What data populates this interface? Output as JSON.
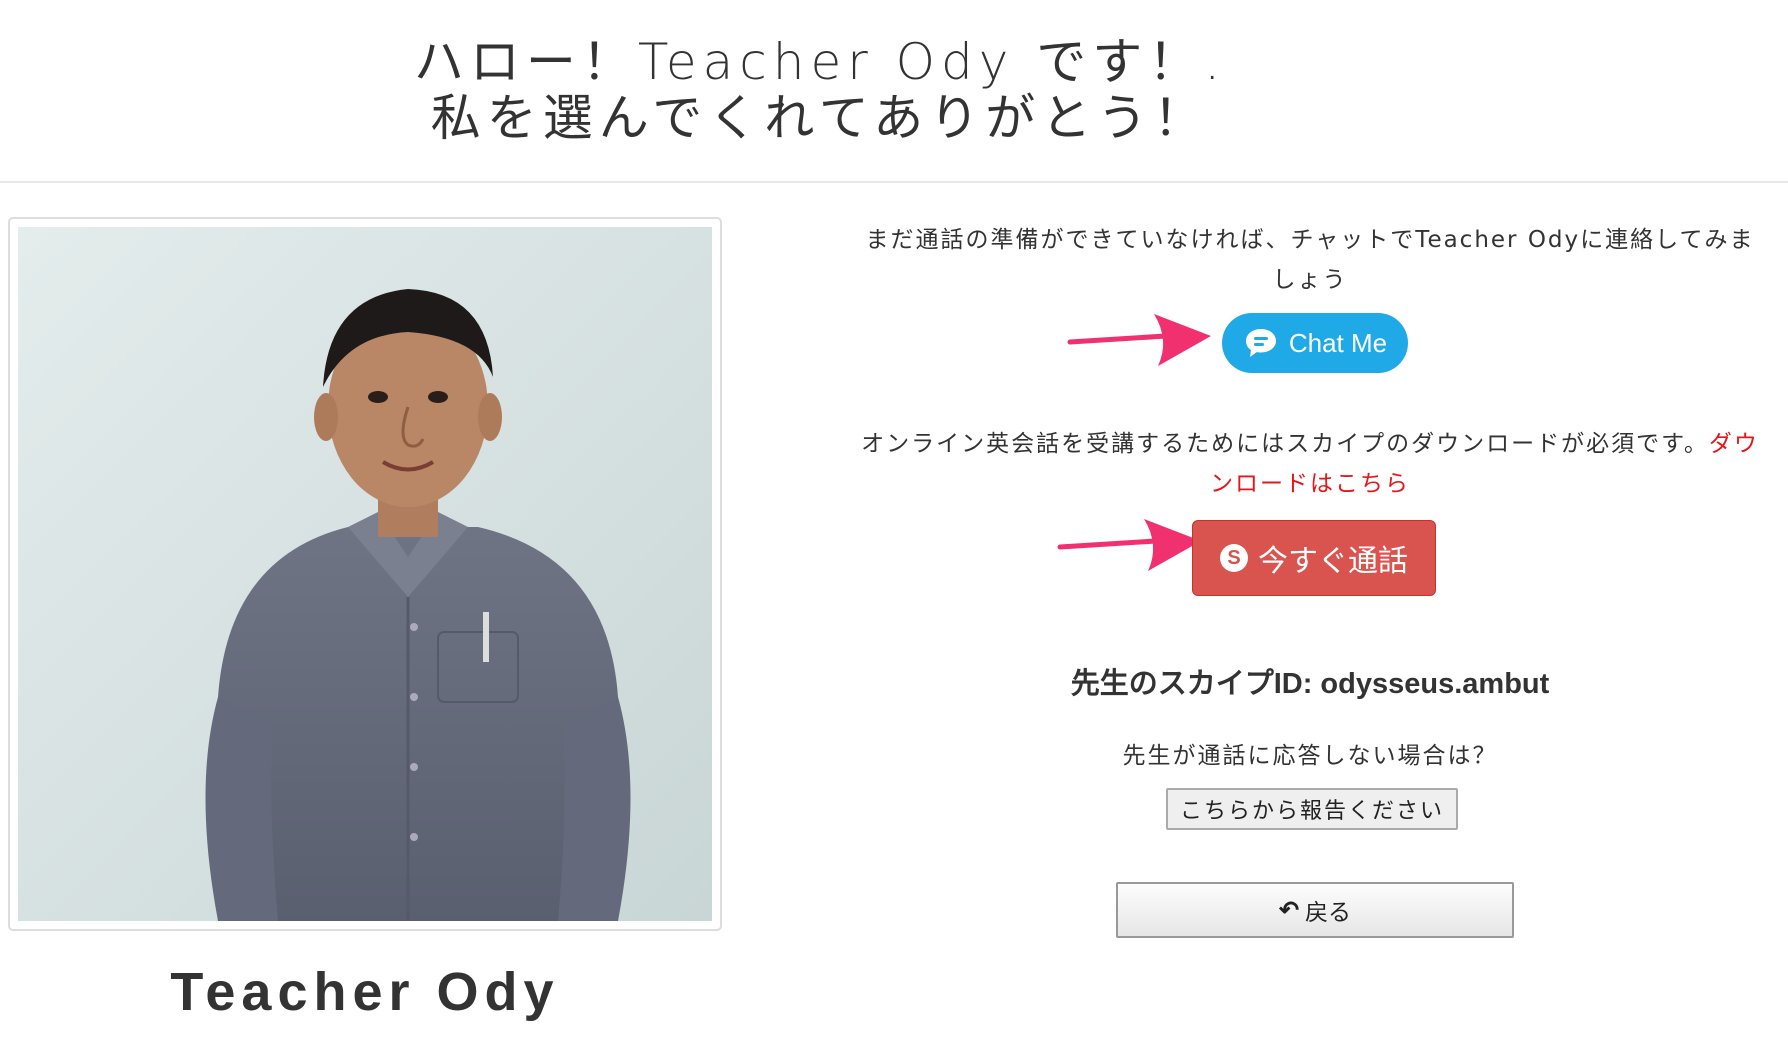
{
  "header": {
    "title_line1": "ハロー！Teacher Ody です！.",
    "title_line2": "私を選んでくれてありがとう！"
  },
  "teacher": {
    "name": "Teacher Ody",
    "photo_icon": "teacher-portrait"
  },
  "chat_section": {
    "text": "まだ通話の準備ができていなければ、チャットでTeacher Odyに連絡してみましょう",
    "chat_button_label": "Chat Me",
    "chat_icon": "chat-bubble-icon"
  },
  "skype_section": {
    "text": "オンライン英会話を受講するためにはスカイプのダウンロードが必須です。",
    "download_link": "ダウンロードはこちら",
    "call_button_label": "今すぐ通話",
    "call_icon": "skype-icon",
    "skype_id": "先生のスカイプID: odysseus.ambut"
  },
  "report_section": {
    "question": "先生が通話に応答しない場合は？",
    "report_button_label": "こちらから報告ください"
  },
  "back_button_label": "戻る",
  "colors": {
    "chat_button": "#1fa9e6",
    "call_button": "#d9534f",
    "download_link": "#e3161b",
    "arrow": "#f0306f"
  }
}
